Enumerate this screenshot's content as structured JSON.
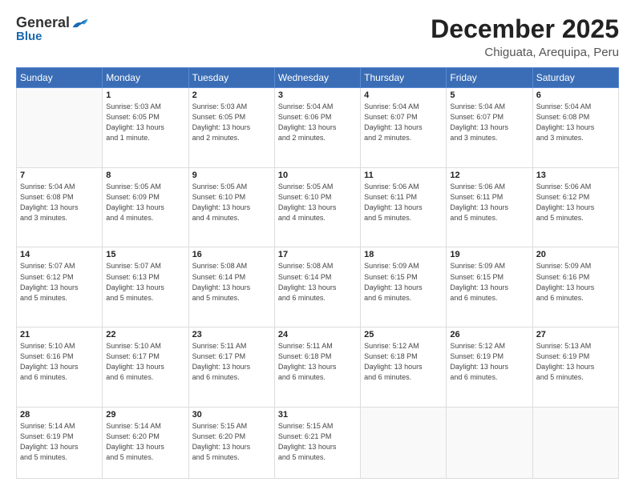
{
  "header": {
    "logo_general": "General",
    "logo_blue": "Blue",
    "month": "December 2025",
    "location": "Chiguata, Arequipa, Peru"
  },
  "weekdays": [
    "Sunday",
    "Monday",
    "Tuesday",
    "Wednesday",
    "Thursday",
    "Friday",
    "Saturday"
  ],
  "weeks": [
    [
      {
        "day": "",
        "info": ""
      },
      {
        "day": "1",
        "info": "Sunrise: 5:03 AM\nSunset: 6:05 PM\nDaylight: 13 hours\nand 1 minute."
      },
      {
        "day": "2",
        "info": "Sunrise: 5:03 AM\nSunset: 6:05 PM\nDaylight: 13 hours\nand 2 minutes."
      },
      {
        "day": "3",
        "info": "Sunrise: 5:04 AM\nSunset: 6:06 PM\nDaylight: 13 hours\nand 2 minutes."
      },
      {
        "day": "4",
        "info": "Sunrise: 5:04 AM\nSunset: 6:07 PM\nDaylight: 13 hours\nand 2 minutes."
      },
      {
        "day": "5",
        "info": "Sunrise: 5:04 AM\nSunset: 6:07 PM\nDaylight: 13 hours\nand 3 minutes."
      },
      {
        "day": "6",
        "info": "Sunrise: 5:04 AM\nSunset: 6:08 PM\nDaylight: 13 hours\nand 3 minutes."
      }
    ],
    [
      {
        "day": "7",
        "info": "Sunrise: 5:04 AM\nSunset: 6:08 PM\nDaylight: 13 hours\nand 3 minutes."
      },
      {
        "day": "8",
        "info": "Sunrise: 5:05 AM\nSunset: 6:09 PM\nDaylight: 13 hours\nand 4 minutes."
      },
      {
        "day": "9",
        "info": "Sunrise: 5:05 AM\nSunset: 6:10 PM\nDaylight: 13 hours\nand 4 minutes."
      },
      {
        "day": "10",
        "info": "Sunrise: 5:05 AM\nSunset: 6:10 PM\nDaylight: 13 hours\nand 4 minutes."
      },
      {
        "day": "11",
        "info": "Sunrise: 5:06 AM\nSunset: 6:11 PM\nDaylight: 13 hours\nand 5 minutes."
      },
      {
        "day": "12",
        "info": "Sunrise: 5:06 AM\nSunset: 6:11 PM\nDaylight: 13 hours\nand 5 minutes."
      },
      {
        "day": "13",
        "info": "Sunrise: 5:06 AM\nSunset: 6:12 PM\nDaylight: 13 hours\nand 5 minutes."
      }
    ],
    [
      {
        "day": "14",
        "info": "Sunrise: 5:07 AM\nSunset: 6:12 PM\nDaylight: 13 hours\nand 5 minutes."
      },
      {
        "day": "15",
        "info": "Sunrise: 5:07 AM\nSunset: 6:13 PM\nDaylight: 13 hours\nand 5 minutes."
      },
      {
        "day": "16",
        "info": "Sunrise: 5:08 AM\nSunset: 6:14 PM\nDaylight: 13 hours\nand 5 minutes."
      },
      {
        "day": "17",
        "info": "Sunrise: 5:08 AM\nSunset: 6:14 PM\nDaylight: 13 hours\nand 6 minutes."
      },
      {
        "day": "18",
        "info": "Sunrise: 5:09 AM\nSunset: 6:15 PM\nDaylight: 13 hours\nand 6 minutes."
      },
      {
        "day": "19",
        "info": "Sunrise: 5:09 AM\nSunset: 6:15 PM\nDaylight: 13 hours\nand 6 minutes."
      },
      {
        "day": "20",
        "info": "Sunrise: 5:09 AM\nSunset: 6:16 PM\nDaylight: 13 hours\nand 6 minutes."
      }
    ],
    [
      {
        "day": "21",
        "info": "Sunrise: 5:10 AM\nSunset: 6:16 PM\nDaylight: 13 hours\nand 6 minutes."
      },
      {
        "day": "22",
        "info": "Sunrise: 5:10 AM\nSunset: 6:17 PM\nDaylight: 13 hours\nand 6 minutes."
      },
      {
        "day": "23",
        "info": "Sunrise: 5:11 AM\nSunset: 6:17 PM\nDaylight: 13 hours\nand 6 minutes."
      },
      {
        "day": "24",
        "info": "Sunrise: 5:11 AM\nSunset: 6:18 PM\nDaylight: 13 hours\nand 6 minutes."
      },
      {
        "day": "25",
        "info": "Sunrise: 5:12 AM\nSunset: 6:18 PM\nDaylight: 13 hours\nand 6 minutes."
      },
      {
        "day": "26",
        "info": "Sunrise: 5:12 AM\nSunset: 6:19 PM\nDaylight: 13 hours\nand 6 minutes."
      },
      {
        "day": "27",
        "info": "Sunrise: 5:13 AM\nSunset: 6:19 PM\nDaylight: 13 hours\nand 5 minutes."
      }
    ],
    [
      {
        "day": "28",
        "info": "Sunrise: 5:14 AM\nSunset: 6:19 PM\nDaylight: 13 hours\nand 5 minutes."
      },
      {
        "day": "29",
        "info": "Sunrise: 5:14 AM\nSunset: 6:20 PM\nDaylight: 13 hours\nand 5 minutes."
      },
      {
        "day": "30",
        "info": "Sunrise: 5:15 AM\nSunset: 6:20 PM\nDaylight: 13 hours\nand 5 minutes."
      },
      {
        "day": "31",
        "info": "Sunrise: 5:15 AM\nSunset: 6:21 PM\nDaylight: 13 hours\nand 5 minutes."
      },
      {
        "day": "",
        "info": ""
      },
      {
        "day": "",
        "info": ""
      },
      {
        "day": "",
        "info": ""
      }
    ]
  ]
}
